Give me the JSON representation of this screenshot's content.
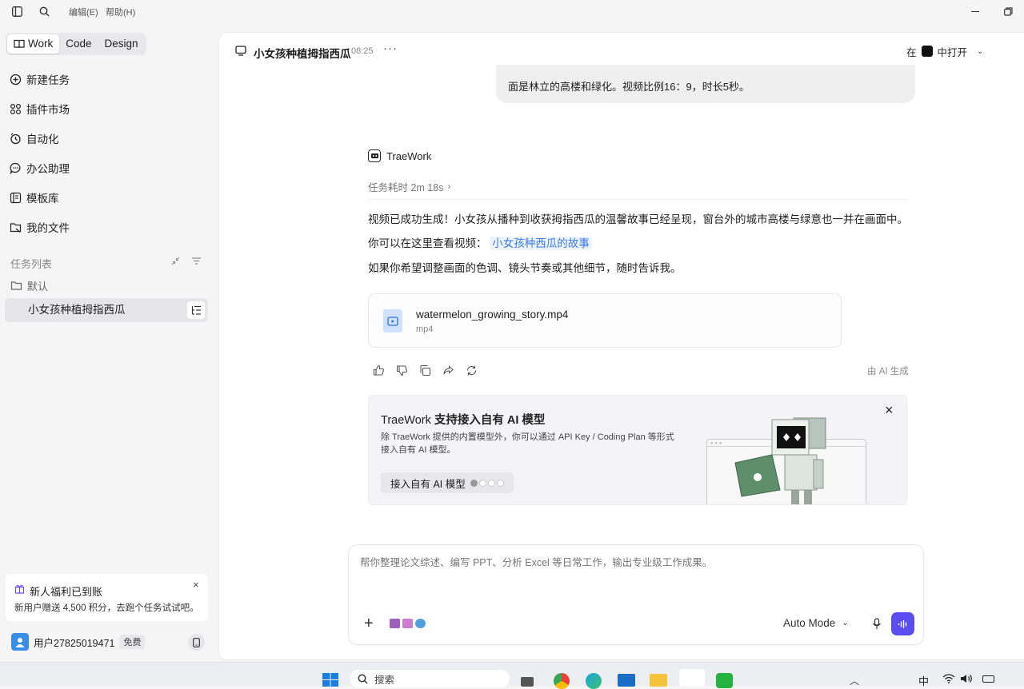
{
  "menu": {
    "edit": "编辑(E)",
    "help": "帮助(H)"
  },
  "sidebar": {
    "modes": [
      "Work",
      "Code",
      "Design"
    ],
    "nav": [
      {
        "label": "新建任务",
        "icon": "new-task-icon"
      },
      {
        "label": "插件市场",
        "icon": "plugin-icon"
      },
      {
        "label": "自动化",
        "icon": "clock-icon"
      },
      {
        "label": "办公助理",
        "icon": "chat-icon"
      },
      {
        "label": "模板库",
        "icon": "template-icon"
      },
      {
        "label": "我的文件",
        "icon": "files-icon"
      }
    ],
    "task_list_label": "任务列表",
    "folder": "默认",
    "active_task": "小女孩种植拇指西瓜",
    "promo": {
      "title": "新人福利已到账",
      "body": "新用户赠送 4,500 积分，去跑个任务试试吧。"
    },
    "user": {
      "name": "用户27825019471",
      "badge": "免费"
    }
  },
  "header": {
    "title": "小女孩种植拇指西瓜",
    "time": "08:25",
    "open_prefix": "在",
    "open_label": "中打开"
  },
  "chat": {
    "user_tail": "面是林立的高楼和绿化。视频比例16：9，时长5秒。",
    "agent": "TraeWork",
    "duration": "任务耗时 2m 18s",
    "p1": "视频已成功生成！小女孩从播种到收获拇指西瓜的温馨故事已经呈现，窗台外的城市高楼与绿意也一并在画面中。",
    "p2": "你可以在这里查看视频：",
    "p2_link": "小女孩种西瓜的故事",
    "p3": "如果你希望调整画面的色调、镜头节奏或其他细节，随时告诉我。",
    "file": {
      "name": "watermelon_growing_story.mp4",
      "type": "mp4"
    },
    "ai_note": "由 AI 生成"
  },
  "banner": {
    "title_prefix": "TraeWork ",
    "title": "支持接入自有 AI 模型",
    "line1": "除 TraeWork 提供的内置模型外，你可以通过 API Key / Coding Plan 等形式",
    "line2": "接入自有 AI 模型。",
    "button": "接入自有 AI 模型"
  },
  "input": {
    "placeholder": "帮你整理论文综述、编写 PPT、分析 Excel 等日常工作，输出专业级工作成果。",
    "mode": "Auto Mode"
  },
  "taskbar": {
    "search": "搜索",
    "ime": "中"
  },
  "colors": {
    "accent": "#5b4ef0",
    "link": "#3c7be0",
    "sidebar_bg": "#f5f5f6"
  }
}
